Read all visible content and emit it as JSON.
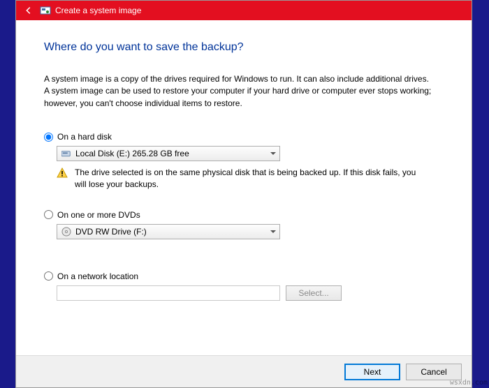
{
  "titlebar": {
    "title": "Create a system image"
  },
  "heading": "Where do you want to save the backup?",
  "description": "A system image is a copy of the drives required for Windows to run. It can also include additional drives. A system image can be used to restore your computer if your hard drive or computer ever stops working; however, you can't choose individual items to restore.",
  "options": {
    "hardDisk": {
      "label": "On a hard disk",
      "selected": "Local Disk (E:)  265.28 GB free",
      "warning": "The drive selected is on the same physical disk that is being backed up. If this disk fails, you will lose your backups."
    },
    "dvd": {
      "label": "On one or more DVDs",
      "selected": "DVD RW Drive (F:)"
    },
    "network": {
      "label": "On a network location",
      "value": "",
      "selectLabel": "Select..."
    }
  },
  "footer": {
    "next": "Next",
    "cancel": "Cancel"
  },
  "watermark": "wsxdn.com"
}
